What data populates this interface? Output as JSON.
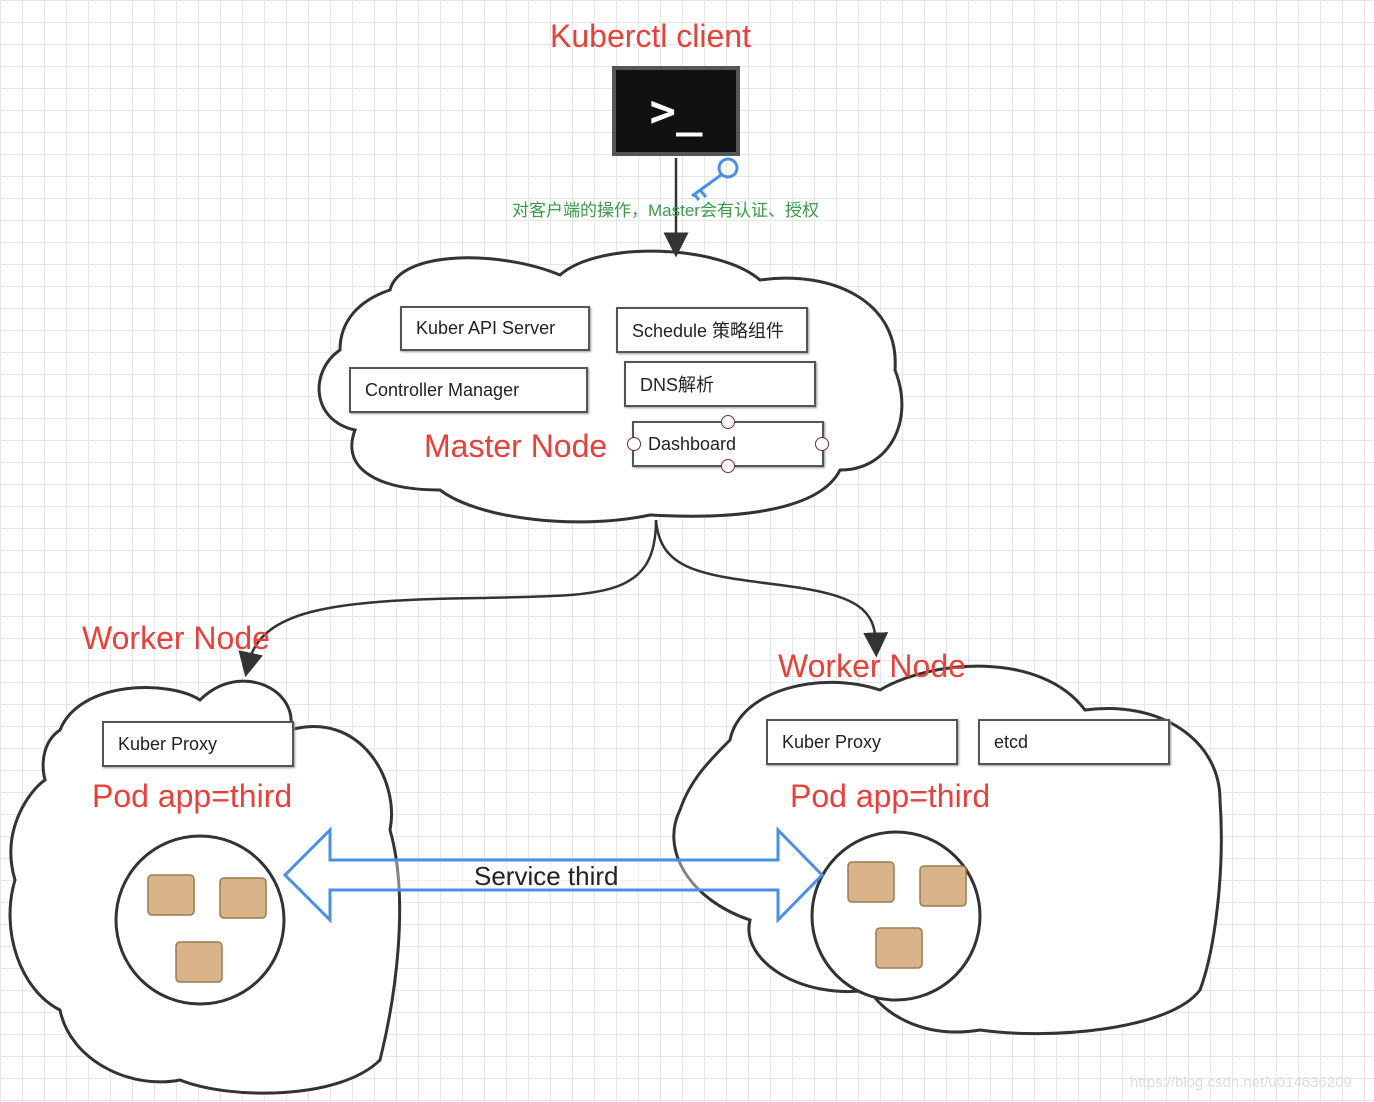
{
  "client": {
    "title": "Kuberctl client",
    "terminal_glyph": ">_",
    "icon": "terminal-icon",
    "key_icon": "key-icon"
  },
  "auth_note": "对客户端的操作，Master会有认证、授权",
  "master": {
    "label": "Master Node",
    "components": [
      "Kuber API Server",
      "Schedule 策略组件",
      "Controller Manager",
      "DNS解析",
      "Dashboard"
    ]
  },
  "worker_left": {
    "label": "Worker Node",
    "components": [
      "Kuber Proxy"
    ],
    "pod": "Pod app=third"
  },
  "worker_right": {
    "label": "Worker Node",
    "components": [
      "Kuber Proxy",
      "etcd"
    ],
    "pod": "Pod app=third"
  },
  "service": "Service third",
  "watermark": "https://blog.csdn.net/u014636209",
  "colors": {
    "label": "#e8403a",
    "note": "#3a9a4a",
    "arrow": "#4a90e2"
  }
}
